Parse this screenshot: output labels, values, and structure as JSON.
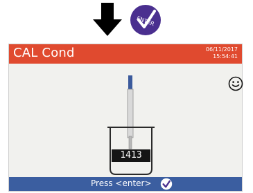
{
  "indicator": {
    "arrow_icon": "down-arrow-icon",
    "enter_key_icon": "enter-key-icon",
    "enter_key_text": "ENTER",
    "enter_key_color": "#4a2f8f"
  },
  "screen": {
    "title": "CAL Cond",
    "date": "06/11/2017",
    "time": "15:54:41",
    "header_color": "#e04a2f",
    "status_icon": "smiley-icon",
    "probe_icon": "conductivity-probe-icon",
    "beaker_icon": "beaker-icon",
    "standard_value": "1413",
    "footer_color": "#3b5ea0",
    "footer_prompt": "Press <enter>",
    "footer_icon": "check-icon"
  }
}
